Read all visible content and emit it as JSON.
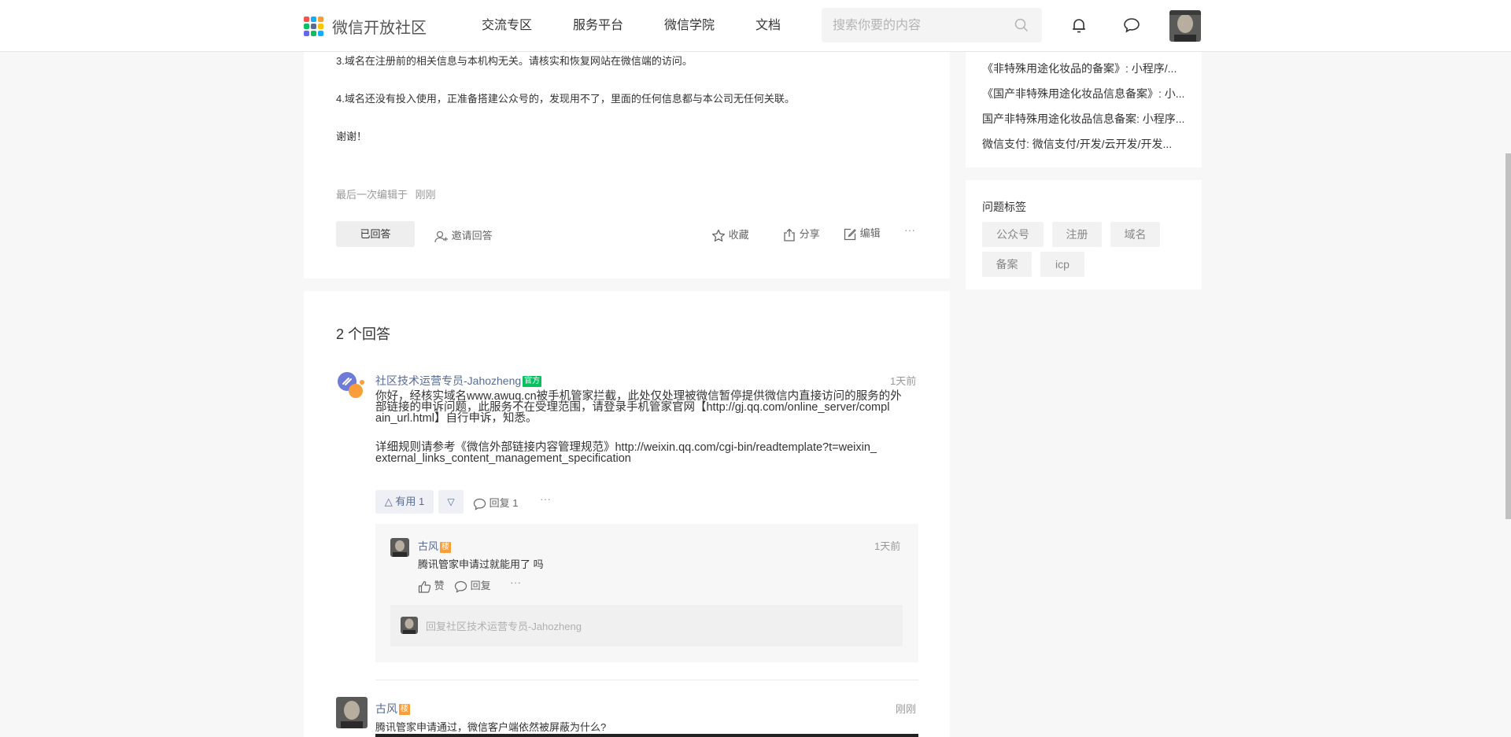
{
  "header": {
    "logo_text": "微信开放社区",
    "nav": [
      "交流专区",
      "服务平台",
      "微信学院",
      "文档"
    ],
    "search_placeholder": "搜索你要的内容"
  },
  "question": {
    "lines": [
      "3.域名在注册前的相关信息与本机构无关。请核实和恢复网站在微信端的访问。",
      "4.域名还没有投入使用，正准备搭建公众号的，发现用不了，里面的任何信息都与本公司无任何关联。",
      "谢谢！"
    ],
    "last_edit_label": "最后一次编辑于",
    "last_edit_time": "刚刚",
    "answered_label": "已回答",
    "invite_label": "邀请回答",
    "favorite_label": "收藏",
    "share_label": "分享",
    "edit_label": "编辑",
    "more": "···"
  },
  "answers": {
    "count_title": "2 个回答",
    "first": {
      "author": "社区技术运营专员-Jahozheng",
      "badge": "官方",
      "time": "1天前",
      "lines": [
        "你好，经核实域名www.awuq.cn被手机管家拦截，此处仅处理被微信暂停提供微信内直接访问的服务的外",
        "部链接的申诉问题，此服务不在受理范围，请登录手机管家官网【http://gj.qq.com/online_server/compl",
        "ain_url.html】自行申诉，知悉。"
      ],
      "lines2": [
        "详细规则请参考《微信外部链接内容管理规范》http://weixin.qq.com/cgi-bin/readtemplate?t=weixin_",
        "external_links_content_management_specification"
      ],
      "useful_label": "有用 1",
      "reply_label": "回复 1",
      "more": "···",
      "comment": {
        "author": "古风",
        "badge": "楼",
        "time": "1天前",
        "text": "腾讯管家申请过就能用了 吗",
        "like_label": "赞",
        "reply_label": "回复",
        "more": "···",
        "reply_placeholder": "回复社区技术运营专员-Jahozheng"
      }
    },
    "second": {
      "author": "古风",
      "badge": "楼",
      "time": "刚刚",
      "text": "腾讯管家申请通过，微信客户端依然被屏蔽为什么?"
    }
  },
  "sidebar": {
    "related": [
      "《非特殊用途化妆品的备案》: 小程序/...",
      "《国产非特殊用途化妆品信息备案》: 小...",
      "国产非特殊用途化妆品信息备案: 小程序...",
      "微信支付: 微信支付/开发/云开发/开发..."
    ],
    "tags_title": "问题标签",
    "tags": [
      "公众号",
      "注册",
      "域名",
      "备案",
      "icp"
    ]
  },
  "colors": {
    "link_blue": "#576b95",
    "official_green": "#07c160",
    "floor_orange": "#fa9d3b"
  }
}
